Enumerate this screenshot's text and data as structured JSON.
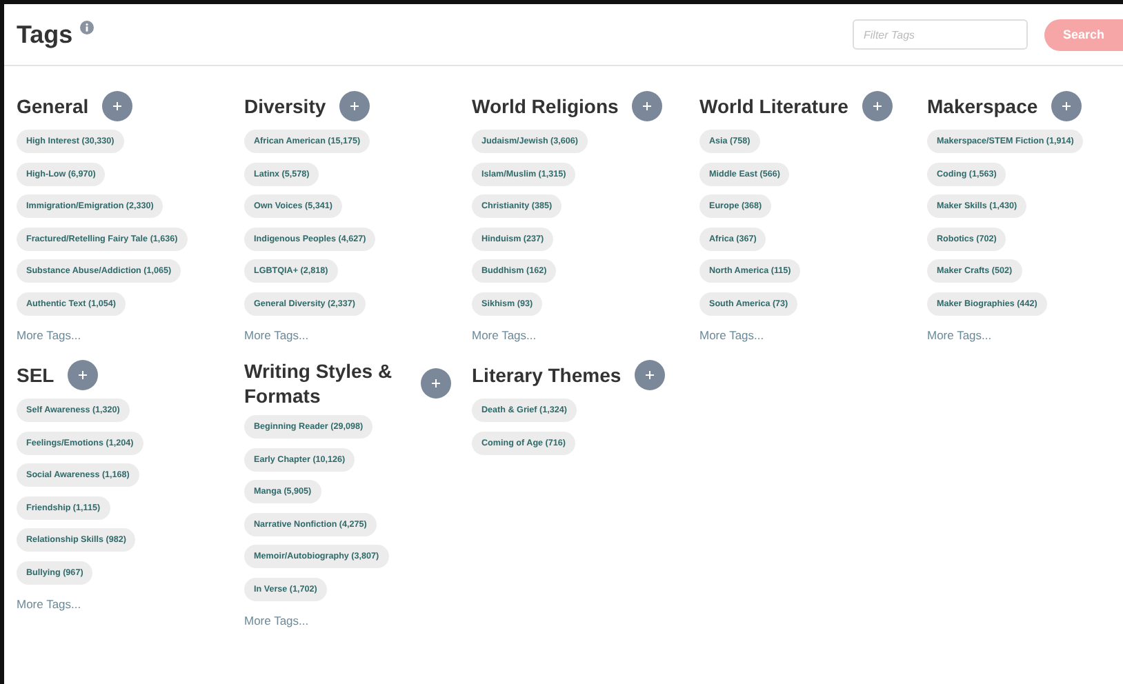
{
  "header": {
    "title": "Tags",
    "filter": {
      "placeholder": "Filter Tags"
    },
    "search_button": "Search"
  },
  "categories": [
    {
      "name": "General",
      "tags": [
        "High Interest (30,330)",
        "High-Low (6,970)",
        "Immigration/Emigration (2,330)",
        "Fractured/Retelling Fairy Tale (1,636)",
        "Substance Abuse/Addiction (1,065)",
        "Authentic Text (1,054)"
      ],
      "more": "More Tags..."
    },
    {
      "name": "Diversity",
      "tags": [
        "African American (15,175)",
        "Latinx (5,578)",
        "Own Voices (5,341)",
        "Indigenous Peoples (4,627)",
        "LGBTQIA+ (2,818)",
        "General Diversity (2,337)"
      ],
      "more": "More Tags..."
    },
    {
      "name": "World Religions",
      "tags": [
        "Judaism/Jewish (3,606)",
        "Islam/Muslim (1,315)",
        "Christianity (385)",
        "Hinduism (237)",
        "Buddhism (162)",
        "Sikhism (93)"
      ],
      "more": "More Tags..."
    },
    {
      "name": "World Literature",
      "tags": [
        "Asia (758)",
        "Middle East (566)",
        "Europe (368)",
        "Africa (367)",
        "North America (115)",
        "South America (73)"
      ],
      "more": "More Tags..."
    },
    {
      "name": "Makerspace",
      "tags": [
        "Makerspace/STEM Fiction (1,914)",
        "Coding (1,563)",
        "Maker Skills (1,430)",
        "Robotics (702)",
        "Maker Crafts (502)",
        "Maker Biographies (442)"
      ],
      "more": "More Tags..."
    },
    {
      "name": "SEL",
      "tags": [
        "Self Awareness (1,320)",
        "Feelings/Emotions (1,204)",
        "Social Awareness (1,168)",
        "Friendship (1,115)",
        "Relationship Skills (982)",
        "Bullying (967)"
      ],
      "more": "More Tags..."
    },
    {
      "name": "Writing Styles & Formats",
      "tags": [
        "Beginning Reader (29,098)",
        "Early Chapter (10,126)",
        "Manga (5,905)",
        "Narrative Nonfiction (4,275)",
        "Memoir/Autobiography (3,807)",
        "In Verse (1,702)"
      ],
      "more": "More Tags..."
    },
    {
      "name": "Literary Themes",
      "tags": [
        "Death & Grief (1,324)",
        "Coming of Age (716)"
      ]
    }
  ]
}
